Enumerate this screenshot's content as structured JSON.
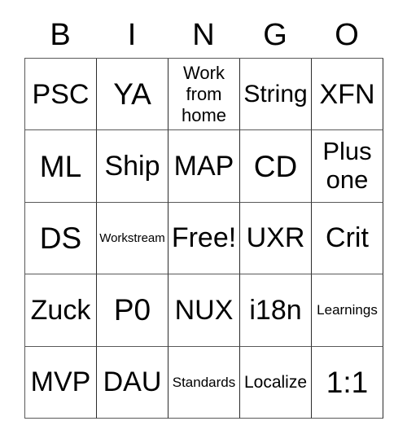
{
  "card": {
    "title_letters": [
      "B",
      "I",
      "N",
      "G",
      "O"
    ],
    "columns": 5,
    "rows": 5,
    "border_color": "#595959",
    "text_color": "#000000",
    "background_color": "#ffffff",
    "free_space_label": "Free!",
    "free_space_position": "center",
    "cells": [
      [
        {
          "text": "PSC",
          "size": "fs-lg"
        },
        {
          "text": "YA",
          "size": "fs-xl"
        },
        {
          "text": "Work\nfrom\nhome",
          "size": "multi3"
        },
        {
          "text": "String",
          "size": "fs-md"
        },
        {
          "text": "XFN",
          "size": "fs-lg"
        }
      ],
      [
        {
          "text": "ML",
          "size": "fs-xl"
        },
        {
          "text": "Ship",
          "size": "fs-lg"
        },
        {
          "text": "MAP",
          "size": "fs-lg"
        },
        {
          "text": "CD",
          "size": "fs-xl"
        },
        {
          "text": "Plus\none",
          "size": "multi2"
        }
      ],
      [
        {
          "text": "DS",
          "size": "fs-xl"
        },
        {
          "text": "Workstream",
          "size": "fs-xxs"
        },
        {
          "text": "Free!",
          "size": "fs-lg"
        },
        {
          "text": "UXR",
          "size": "fs-lg"
        },
        {
          "text": "Crit",
          "size": "fs-lg"
        }
      ],
      [
        {
          "text": "Zuck",
          "size": "fs-lg"
        },
        {
          "text": "P0",
          "size": "fs-xl"
        },
        {
          "text": "NUX",
          "size": "fs-lg"
        },
        {
          "text": "i18n",
          "size": "fs-lg"
        },
        {
          "text": "Learnings",
          "size": "fs-xs"
        }
      ],
      [
        {
          "text": "MVP",
          "size": "fs-lg"
        },
        {
          "text": "DAU",
          "size": "fs-lg"
        },
        {
          "text": "Standards",
          "size": "fs-xs"
        },
        {
          "text": "Localize",
          "size": "fs-sm"
        },
        {
          "text": "1:1",
          "size": "fs-xl"
        }
      ]
    ]
  }
}
